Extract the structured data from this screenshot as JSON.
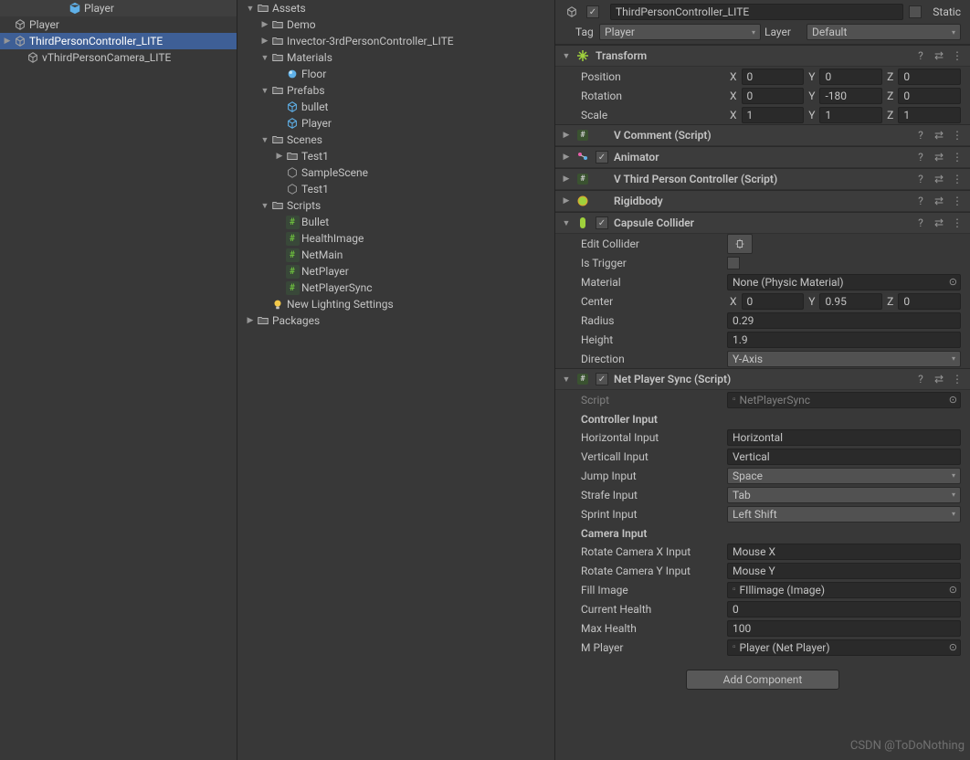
{
  "hierarchy": {
    "root": "Player",
    "children": [
      {
        "name": "Player",
        "icon": "cube"
      },
      {
        "name": "ThirdPersonController_LITE",
        "icon": "cube",
        "selected": true,
        "expandable": true
      },
      {
        "name": "vThirdPersonCamera_LITE",
        "icon": "cube",
        "indent": 1
      }
    ]
  },
  "project": {
    "items": [
      {
        "name": "Assets",
        "icon": "folder",
        "fold": "down",
        "indent": 0
      },
      {
        "name": "Demo",
        "icon": "folder",
        "fold": "right",
        "indent": 1
      },
      {
        "name": "Invector-3rdPersonController_LITE",
        "icon": "folder",
        "fold": "right",
        "indent": 1
      },
      {
        "name": "Materials",
        "icon": "folder",
        "fold": "down",
        "indent": 1
      },
      {
        "name": "Floor",
        "icon": "mat",
        "fold": "",
        "indent": 2
      },
      {
        "name": "Prefabs",
        "icon": "folder",
        "fold": "down",
        "indent": 1
      },
      {
        "name": "bullet",
        "icon": "cube-blue",
        "fold": "",
        "indent": 2
      },
      {
        "name": "Player",
        "icon": "cube-blue",
        "fold": "",
        "indent": 2
      },
      {
        "name": "Scenes",
        "icon": "folder",
        "fold": "down",
        "indent": 1
      },
      {
        "name": "Test1",
        "icon": "folder",
        "fold": "right",
        "indent": 2
      },
      {
        "name": "SampleScene",
        "icon": "scene",
        "fold": "",
        "indent": 2
      },
      {
        "name": "Test1",
        "icon": "scene",
        "fold": "",
        "indent": 2
      },
      {
        "name": "Scripts",
        "icon": "folder",
        "fold": "down",
        "indent": 1
      },
      {
        "name": "Bullet",
        "icon": "cs",
        "fold": "",
        "indent": 2
      },
      {
        "name": "HealthImage",
        "icon": "cs",
        "fold": "",
        "indent": 2
      },
      {
        "name": "NetMain",
        "icon": "cs",
        "fold": "",
        "indent": 2
      },
      {
        "name": "NetPlayer",
        "icon": "cs",
        "fold": "",
        "indent": 2
      },
      {
        "name": "NetPlayerSync",
        "icon": "cs",
        "fold": "",
        "indent": 2
      },
      {
        "name": "New Lighting Settings",
        "icon": "light",
        "fold": "",
        "indent": 1
      },
      {
        "name": "Packages",
        "icon": "folder",
        "fold": "right",
        "indent": 0
      }
    ]
  },
  "inspector": {
    "nameField": "ThirdPersonController_LITE",
    "staticLabel": "Static",
    "tagLabel": "Tag",
    "tagValue": "Player",
    "layerLabel": "Layer",
    "layerValue": "Default",
    "transform": {
      "title": "Transform",
      "positionLabel": "Position",
      "pos": {
        "x": "0",
        "y": "0",
        "z": "0"
      },
      "rotationLabel": "Rotation",
      "rot": {
        "x": "0",
        "y": "-180",
        "z": "0"
      },
      "scaleLabel": "Scale",
      "scl": {
        "x": "1",
        "y": "1",
        "z": "1"
      }
    },
    "vcomment": {
      "title": "V Comment (Script)"
    },
    "animator": {
      "title": "Animator"
    },
    "vthird": {
      "title": "V Third Person Controller (Script)"
    },
    "rigidbody": {
      "title": "Rigidbody"
    },
    "capsule": {
      "title": "Capsule Collider",
      "editCollider": "Edit Collider",
      "isTrigger": "Is Trigger",
      "material": "Material",
      "materialValue": "None (Physic Material)",
      "center": "Center",
      "centerV": {
        "x": "0",
        "y": "0.95",
        "z": "0"
      },
      "radius": "Radius",
      "radiusV": "0.29",
      "height": "Height",
      "heightV": "1.9",
      "direction": "Direction",
      "directionV": "Y-Axis"
    },
    "netsync": {
      "title": "Net Player Sync (Script)",
      "scriptLabel": "Script",
      "scriptValue": "NetPlayerSync",
      "section1": "Controller Input",
      "horizontalInput": "Horizontal Input",
      "horizontalInputV": "Horizontal",
      "verticalInput": "Verticall Input",
      "verticalInputV": "Vertical",
      "jumpInput": "Jump Input",
      "jumpInputV": "Space",
      "strafeInput": "Strafe Input",
      "strafeInputV": "Tab",
      "sprintInput": "Sprint Input",
      "sprintInputV": "Left Shift",
      "section2": "Camera Input",
      "rotX": "Rotate Camera X Input",
      "rotXV": "Mouse X",
      "rotY": "Rotate Camera Y Input",
      "rotYV": "Mouse Y",
      "fillImage": "Fill Image",
      "fillImageV": "FIllimage (Image)",
      "currentHealth": "Current Health",
      "currentHealthV": "0",
      "maxHealth": "Max Health",
      "maxHealthV": "100",
      "mPlayer": "M Player",
      "mPlayerV": "Player (Net Player)"
    },
    "addComponent": "Add Component"
  },
  "watermark": "CSDN @ToDoNothing"
}
